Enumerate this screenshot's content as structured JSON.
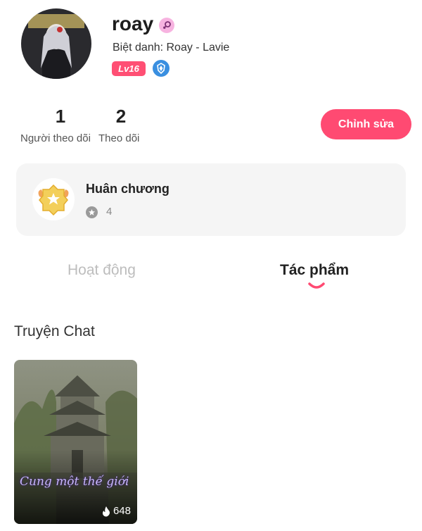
{
  "profile": {
    "username": "roay",
    "nickname": "Biệt danh: Roay - Lavie",
    "level": "Lv16"
  },
  "stats": {
    "followers": {
      "count": "1",
      "label": "Người theo dõi"
    },
    "following": {
      "count": "2",
      "label": "Theo dõi"
    }
  },
  "actions": {
    "edit_label": "Chỉnh sửa"
  },
  "medals": {
    "title": "Huân chương",
    "count": "4"
  },
  "tabs": [
    {
      "label": "Hoạt động",
      "active": false
    },
    {
      "label": "Tác phẩm",
      "active": true
    }
  ],
  "section": {
    "title": "Truyện Chat"
  },
  "works": [
    {
      "title": "Cung một thế giới",
      "views": "648"
    }
  ],
  "colors": {
    "accent": "#ff4a72",
    "tab_inactive": "#bdbdbd",
    "card_bg": "#f5f5f5"
  },
  "icons": {
    "gender": "female-symbol-icon",
    "rank": "blue-shield-icon",
    "medal": "gold-medal-icon",
    "medal_count": "star-circle-icon",
    "views": "flame-icon"
  }
}
